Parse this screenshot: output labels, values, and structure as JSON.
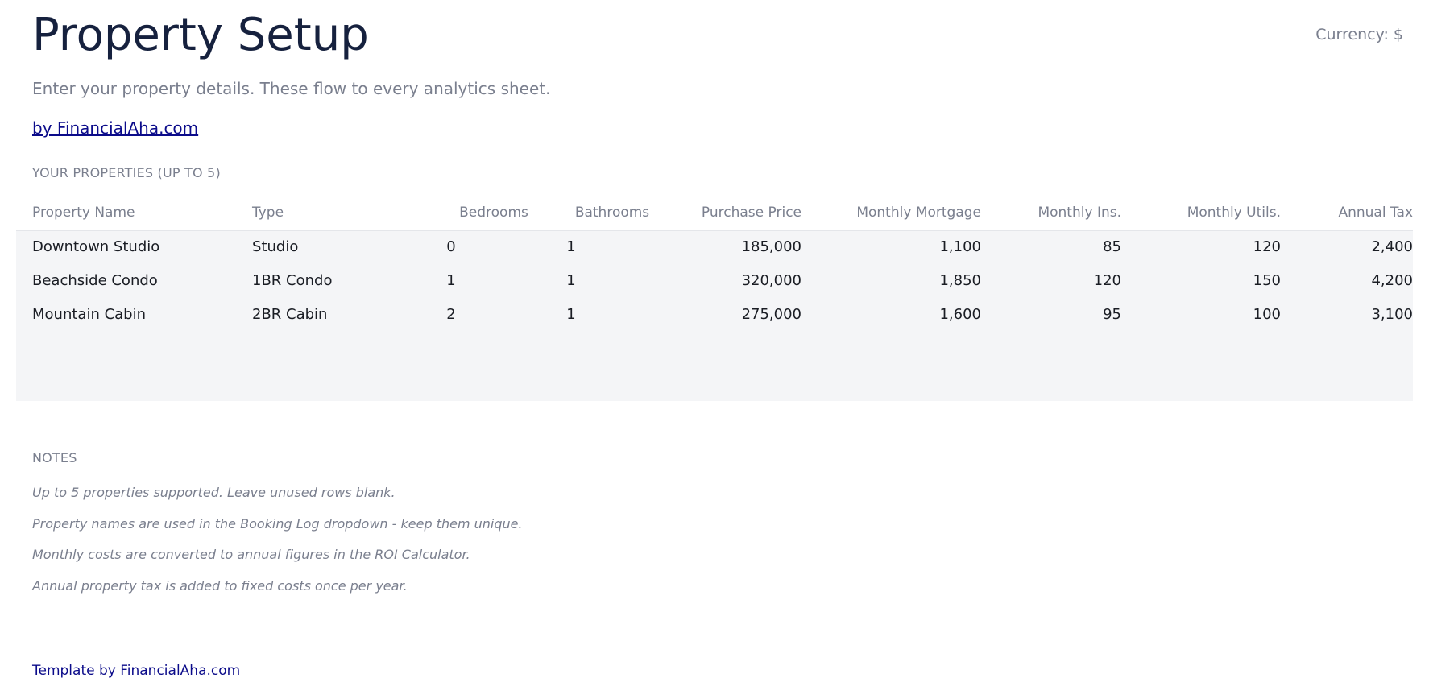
{
  "header": {
    "title": "Property Setup",
    "currency": "Currency: $",
    "subtitle": "Enter your property details. These flow to every analytics sheet.",
    "brand_link": "by FinancialAha.com"
  },
  "properties": {
    "section_label": "YOUR PROPERTIES (UP TO 5)",
    "columns": [
      "Property Name",
      "Type",
      "Bedrooms",
      "Bathrooms",
      "Purchase Price",
      "Monthly Mortgage",
      "Monthly Ins.",
      "Monthly Utils.",
      "Annual Tax"
    ],
    "rows": [
      [
        "Downtown Studio",
        "Studio",
        "0",
        "1",
        "185,000",
        "1,100",
        "85",
        "120",
        "2,400"
      ],
      [
        "Beachside Condo",
        "1BR Condo",
        "1",
        "1",
        "320,000",
        "1,850",
        "120",
        "150",
        "4,200"
      ],
      [
        "Mountain Cabin",
        "2BR Cabin",
        "2",
        "1",
        "275,000",
        "1,600",
        "95",
        "100",
        "3,100"
      ]
    ]
  },
  "notes": {
    "section_label": "NOTES",
    "items": [
      "Up to 5 properties supported. Leave unused rows blank.",
      "Property names are used in the Booking Log dropdown - keep them unique.",
      "Monthly costs are converted to annual figures in the ROI Calculator.",
      "Annual property tax is added to fixed costs once per year."
    ]
  },
  "footer": {
    "link": "Template by FinancialAha.com"
  }
}
